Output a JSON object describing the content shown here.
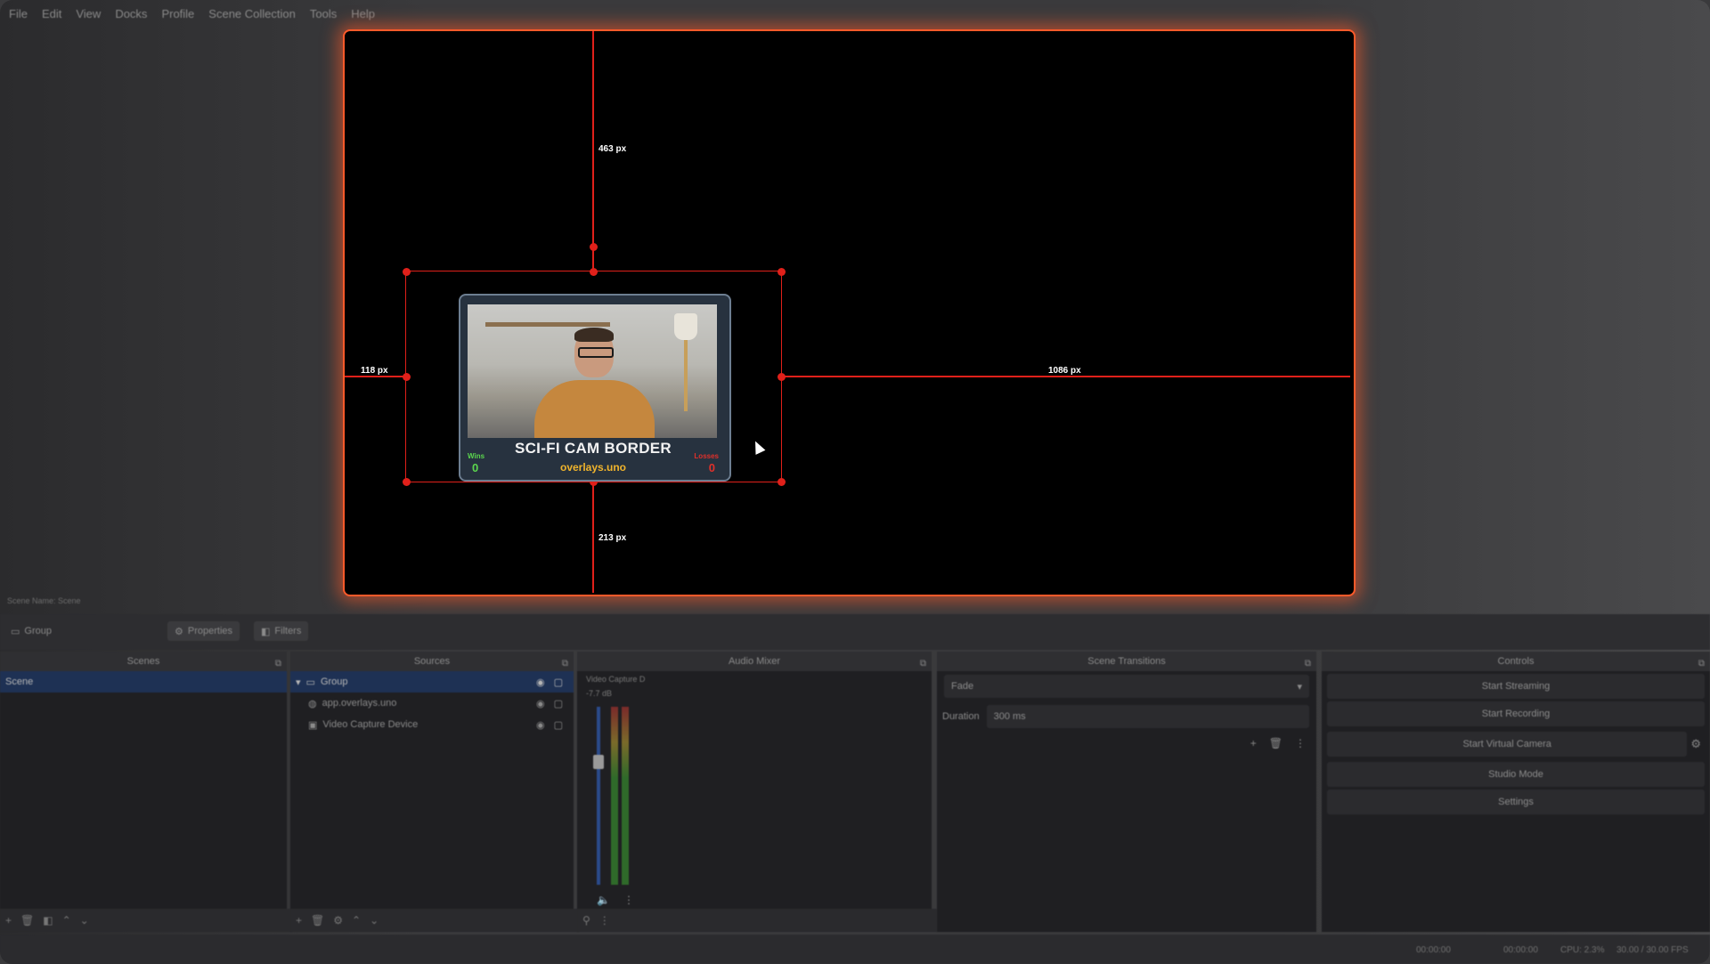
{
  "menu": [
    "File",
    "Edit",
    "View",
    "Docks",
    "Profile",
    "Scene Collection",
    "Tools",
    "Help"
  ],
  "canvas": {
    "guides": {
      "top_label": "463 px",
      "left_label": "118 px",
      "right_label": "1086 px",
      "bottom_label": "213 px"
    },
    "cam_overlay": {
      "title": "SCI-FI CAM BORDER",
      "subtitle": "overlays.uno",
      "wins_label": "Wins",
      "wins_value": "0",
      "losses_label": "Losses",
      "losses_value": "0"
    }
  },
  "scene_name_bar": "Scene Name: Scene",
  "toolbar": {
    "group_label": "Group",
    "properties_label": "Properties",
    "filters_label": "Filters"
  },
  "docks": {
    "scenes": {
      "title": "Scenes",
      "items": [
        "Scene"
      ]
    },
    "sources": {
      "title": "Sources",
      "items": [
        "Group",
        "app.overlays.uno",
        "Video Capture Device"
      ]
    },
    "audio_mixer": {
      "title": "Audio Mixer",
      "channel_name": "Video Capture D",
      "db_value": "-7.7 dB"
    },
    "scene_transitions": {
      "title": "Scene Transitions",
      "transition": "Fade",
      "duration_label": "Duration",
      "duration_value": "300 ms"
    },
    "controls": {
      "title": "Controls",
      "start_streaming": "Start Streaming",
      "start_recording": "Start Recording",
      "start_virtual_camera": "Start Virtual Camera",
      "studio_mode": "Studio Mode",
      "settings": "Settings"
    }
  },
  "status": {
    "stream_time": "00:00:00",
    "record_time": "00:00:00",
    "cpu": "CPU: 2.3%",
    "fps": "30.00 / 30.00 FPS"
  },
  "colors": {
    "guide": "#e0201a",
    "canvas_glow": "#ff5a2a",
    "selected_row": "#1e3154"
  }
}
